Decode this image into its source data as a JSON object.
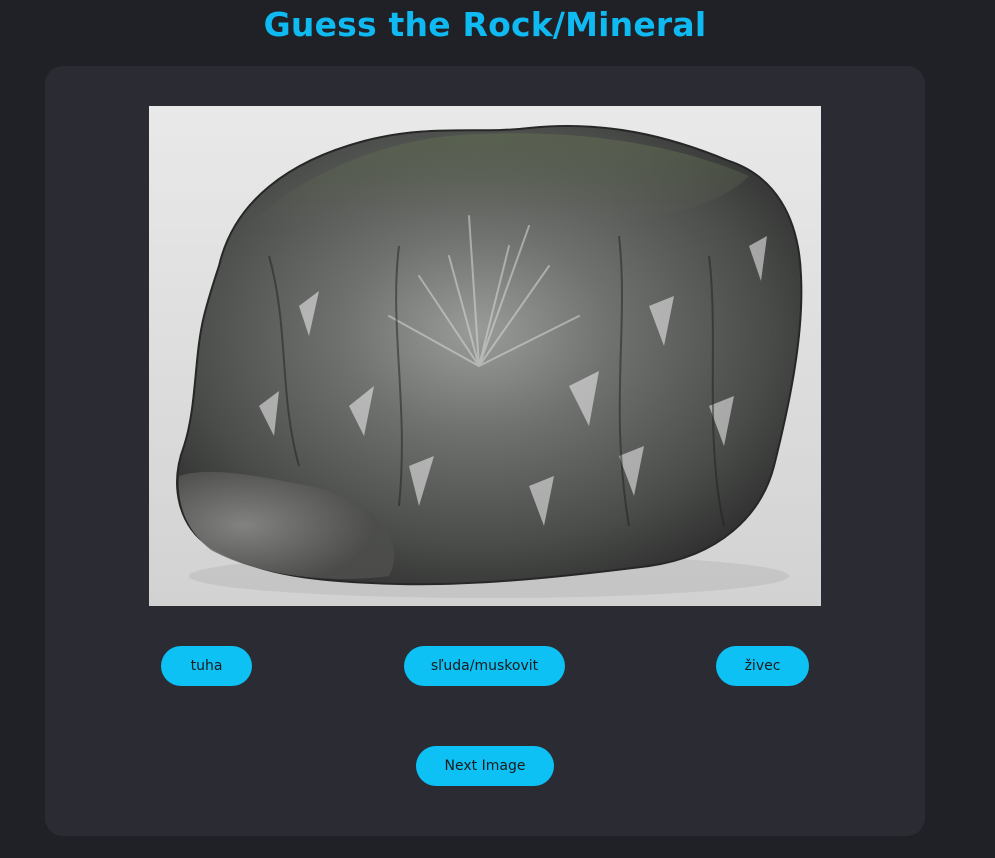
{
  "page": {
    "title": "Guess the Rock/Mineral"
  },
  "quiz": {
    "image_icon": "mineral-specimen-photo",
    "options": [
      {
        "label": "tuha"
      },
      {
        "label": "sľuda/muskovit"
      },
      {
        "label": "živec"
      }
    ],
    "next_label": "Next Image"
  },
  "colors": {
    "background": "#202126",
    "card": "#2b2c33",
    "accent": "#0fb9f1",
    "button": "#0dc1f5"
  }
}
